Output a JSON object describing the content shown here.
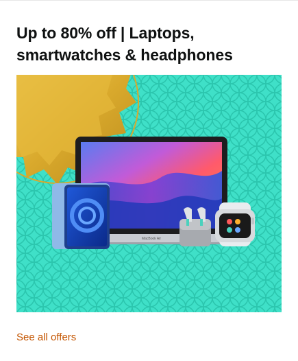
{
  "card": {
    "title_line1": "Up to 80% off | Laptops,",
    "title_line2": "smartwatches & headphones",
    "link_label": "See all offers"
  },
  "colors": {
    "title": "#0f1111",
    "link": "#c45500",
    "background_teal": "#3fe0c8",
    "pattern": "#2bc6ae",
    "gold": "#d9a92c"
  },
  "image": {
    "laptop_badge": "MacBook Air"
  }
}
